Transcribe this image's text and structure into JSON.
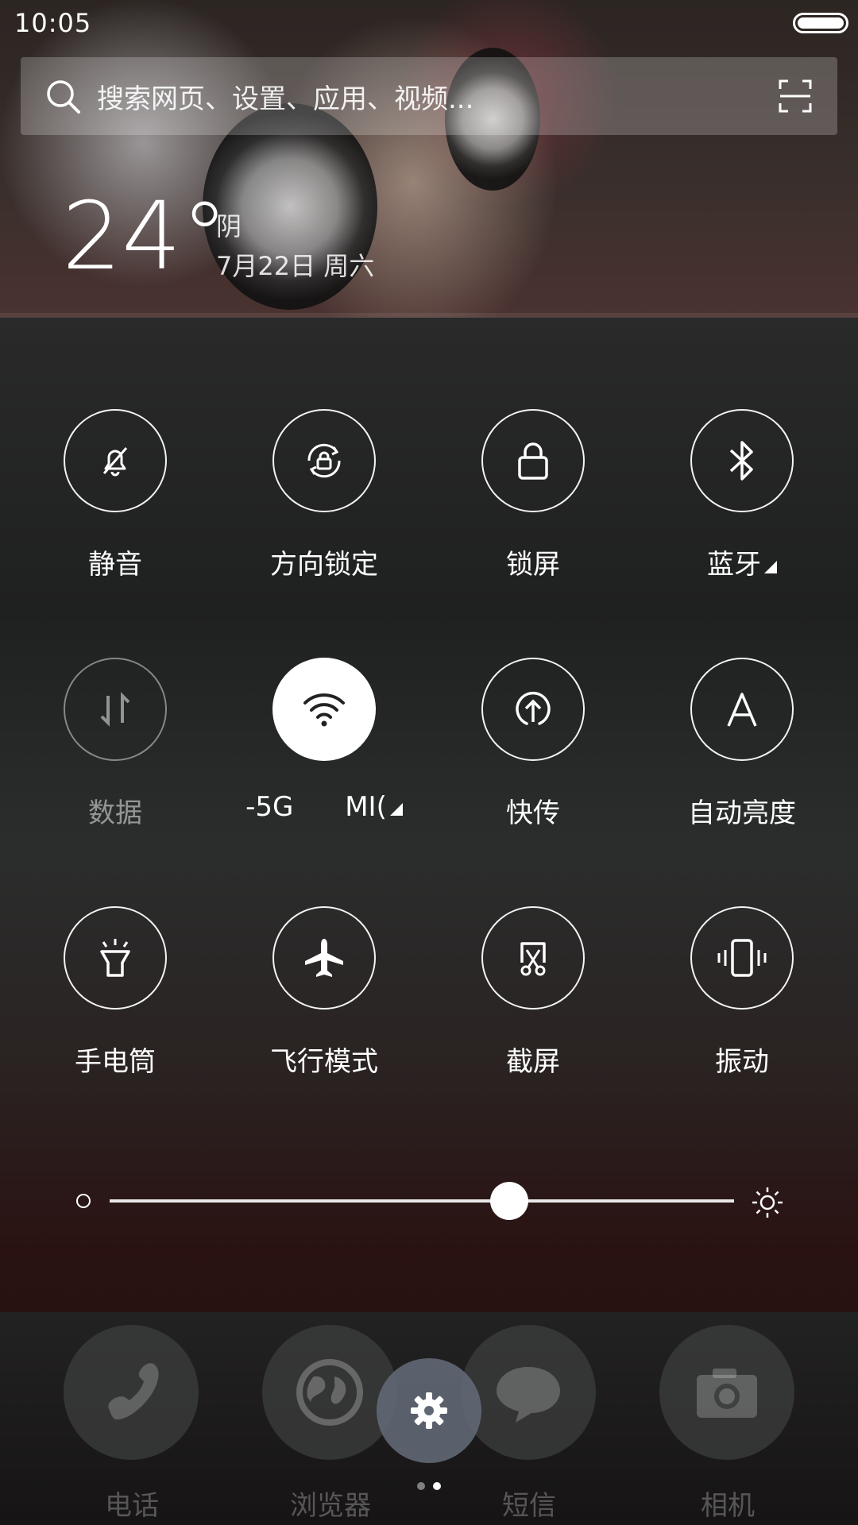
{
  "status_bar": {
    "time": "10:05"
  },
  "search": {
    "placeholder": "搜索网页、设置、应用、视频..."
  },
  "weather": {
    "temperature": "24°",
    "condition": "阴",
    "date": "7月22日 周六"
  },
  "toggles": [
    {
      "label": "静音",
      "icon": "bell-muted-icon",
      "state": "off"
    },
    {
      "label": "方向锁定",
      "icon": "rotation-lock-icon",
      "state": "off"
    },
    {
      "label": "锁屏",
      "icon": "lock-icon",
      "state": "off"
    },
    {
      "label": "蓝牙",
      "icon": "bluetooth-icon",
      "state": "off",
      "has_menu": true
    },
    {
      "label": "数据",
      "icon": "mobile-data-icon",
      "state": "disabled"
    },
    {
      "label": "-5G      MI(",
      "icon": "wifi-icon",
      "state": "on",
      "has_menu": true
    },
    {
      "label": "快传",
      "icon": "quick-transfer-icon",
      "state": "off"
    },
    {
      "label": "自动亮度",
      "icon": "auto-brightness-icon",
      "state": "off"
    },
    {
      "label": "手电筒",
      "icon": "flashlight-icon",
      "state": "off"
    },
    {
      "label": "飞行模式",
      "icon": "airplane-icon",
      "state": "off"
    },
    {
      "label": "截屏",
      "icon": "screenshot-icon",
      "state": "off"
    },
    {
      "label": "振动",
      "icon": "vibrate-icon",
      "state": "off"
    }
  ],
  "brightness": {
    "level": 0.64
  },
  "dock": {
    "apps": [
      {
        "label": "电话",
        "icon": "phone-icon"
      },
      {
        "label": "浏览器",
        "icon": "globe-icon"
      },
      {
        "label": "短信",
        "icon": "message-icon"
      },
      {
        "label": "相机",
        "icon": "camera-icon"
      }
    ],
    "settings_icon": "gear-icon",
    "page_count": 2,
    "current_page": 2
  },
  "colors": {
    "accent": "#ffffff",
    "wifi_active_bg": "#ffffff",
    "settings_fab": "#606874"
  }
}
